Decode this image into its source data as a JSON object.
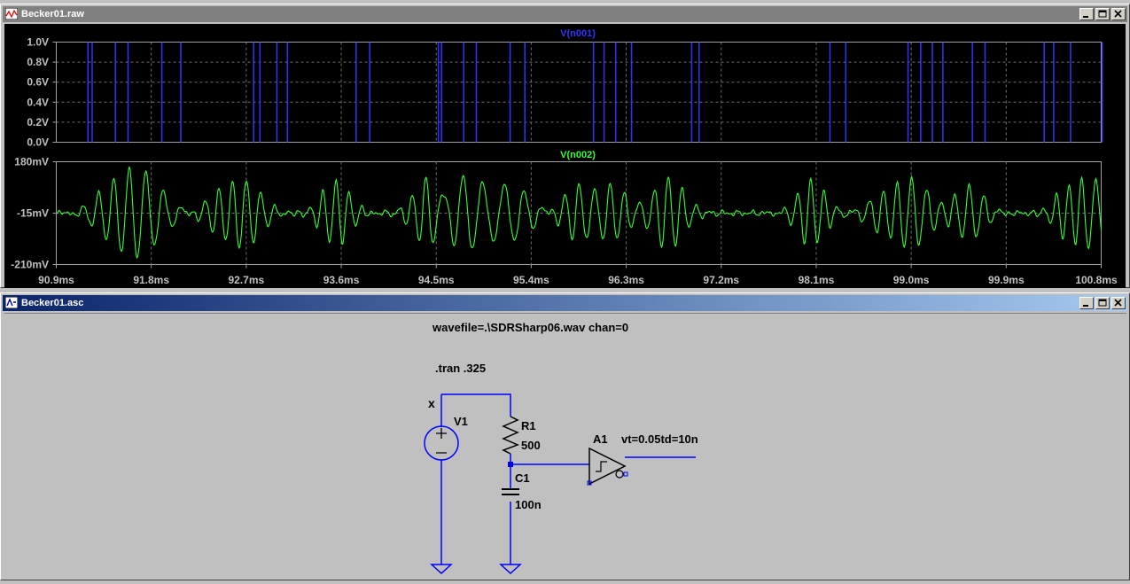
{
  "waveform_window": {
    "title": "Becker01.raw",
    "icon": "waveform-icon",
    "traces": [
      {
        "label": "V(n001)",
        "color": "#3333ff"
      },
      {
        "label": "V(n002)",
        "color": "#33ff33"
      }
    ],
    "upper_y_ticks": [
      "1.0V",
      "0.8V",
      "0.6V",
      "0.4V",
      "0.2V",
      "0.0V"
    ],
    "lower_y_ticks": [
      "180mV",
      "-15mV",
      "-210mV"
    ],
    "x_ticks": [
      "90.9ms",
      "91.8ms",
      "92.7ms",
      "93.6ms",
      "94.5ms",
      "95.4ms",
      "96.3ms",
      "97.2ms",
      "98.1ms",
      "99.0ms",
      "99.9ms",
      "100.8ms"
    ]
  },
  "schematic_window": {
    "title": "Becker01.asc",
    "icon": "schematic-icon",
    "directives": {
      "wavefile": "wavefile=.\\SDRSharp06.wav chan=0",
      "tran": ".tran .325"
    },
    "components": {
      "v1": {
        "name": "V1"
      },
      "r1": {
        "name": "R1",
        "value": "500"
      },
      "c1": {
        "name": "C1",
        "value": "100n"
      },
      "a1": {
        "name": "A1",
        "params": "vt=0.05td=10n"
      },
      "net_label": "x"
    }
  },
  "window_buttons": [
    "minimize",
    "maximize",
    "close"
  ],
  "chart_data": [
    {
      "type": "line",
      "title": "V(n001)",
      "series": [
        {
          "name": "V(n001)",
          "color": "#3333ff"
        }
      ],
      "x_ticks": [
        "90.9ms",
        "91.8ms",
        "92.7ms",
        "93.6ms",
        "94.5ms",
        "95.4ms",
        "96.3ms",
        "97.2ms",
        "98.1ms",
        "99.0ms",
        "99.9ms",
        "100.8ms"
      ],
      "xlim_ms": [
        90.9,
        100.8
      ],
      "ylim": [
        0,
        1.0
      ],
      "y_ticks": [
        "0.0V",
        "0.2V",
        "0.4V",
        "0.6V",
        "0.8V",
        "1.0V"
      ],
      "grid": true,
      "transitions_ms": [
        91.2,
        91.24,
        91.46,
        91.58,
        91.9,
        92.08,
        92.77,
        92.83,
        92.99,
        93.09,
        93.74,
        93.87,
        94.52,
        94.55,
        94.76,
        94.88,
        95.2,
        95.34,
        95.99,
        96.09,
        96.2,
        96.35,
        96.92,
        96.99,
        98.23,
        98.38,
        98.97,
        99.09,
        99.2,
        99.3,
        99.58,
        99.7,
        100.26,
        100.35,
        100.51,
        100.81
      ],
      "high_level": 1.0,
      "low_level": 0.0
    },
    {
      "type": "line",
      "title": "V(n002)",
      "series": [
        {
          "name": "V(n002)",
          "color": "#33ff33"
        }
      ],
      "xlim_ms": [
        90.9,
        100.8
      ],
      "ylim_mV": [
        -210,
        180
      ],
      "y_ticks": [
        "-210mV",
        "-15mV",
        "180mV"
      ],
      "grid": true,
      "bursts": [
        {
          "t": 91.45,
          "a": 120,
          "f": 1.6,
          "w": 0.18
        },
        {
          "t": 91.75,
          "a": 120,
          "f": 1.4,
          "w": 0.2
        },
        {
          "t": 92.45,
          "a": 80,
          "f": 1.8,
          "w": 0.15
        },
        {
          "t": 92.7,
          "a": 110,
          "f": 1.7,
          "w": 0.16
        },
        {
          "t": 93.55,
          "a": 130,
          "f": 1.9,
          "w": 0.14
        },
        {
          "t": 94.4,
          "a": 100,
          "f": 1.9,
          "w": 0.13
        },
        {
          "t": 94.75,
          "a": 140,
          "f": 1.4,
          "w": 0.2
        },
        {
          "t": 95.15,
          "a": 125,
          "f": 1.3,
          "w": 0.2
        },
        {
          "t": 95.85,
          "a": 110,
          "f": 1.8,
          "w": 0.14
        },
        {
          "t": 96.15,
          "a": 105,
          "f": 1.8,
          "w": 0.15
        },
        {
          "t": 96.7,
          "a": 135,
          "f": 1.8,
          "w": 0.14
        },
        {
          "t": 98.05,
          "a": 125,
          "f": 1.9,
          "w": 0.13
        },
        {
          "t": 98.75,
          "a": 100,
          "f": 1.7,
          "w": 0.15
        },
        {
          "t": 99.0,
          "a": 130,
          "f": 1.6,
          "w": 0.18
        },
        {
          "t": 99.55,
          "a": 110,
          "f": 1.7,
          "w": 0.15
        },
        {
          "t": 100.5,
          "a": 125,
          "f": 1.9,
          "w": 0.13
        },
        {
          "t": 100.75,
          "a": 110,
          "f": 1.6,
          "w": 0.15
        }
      ]
    }
  ]
}
